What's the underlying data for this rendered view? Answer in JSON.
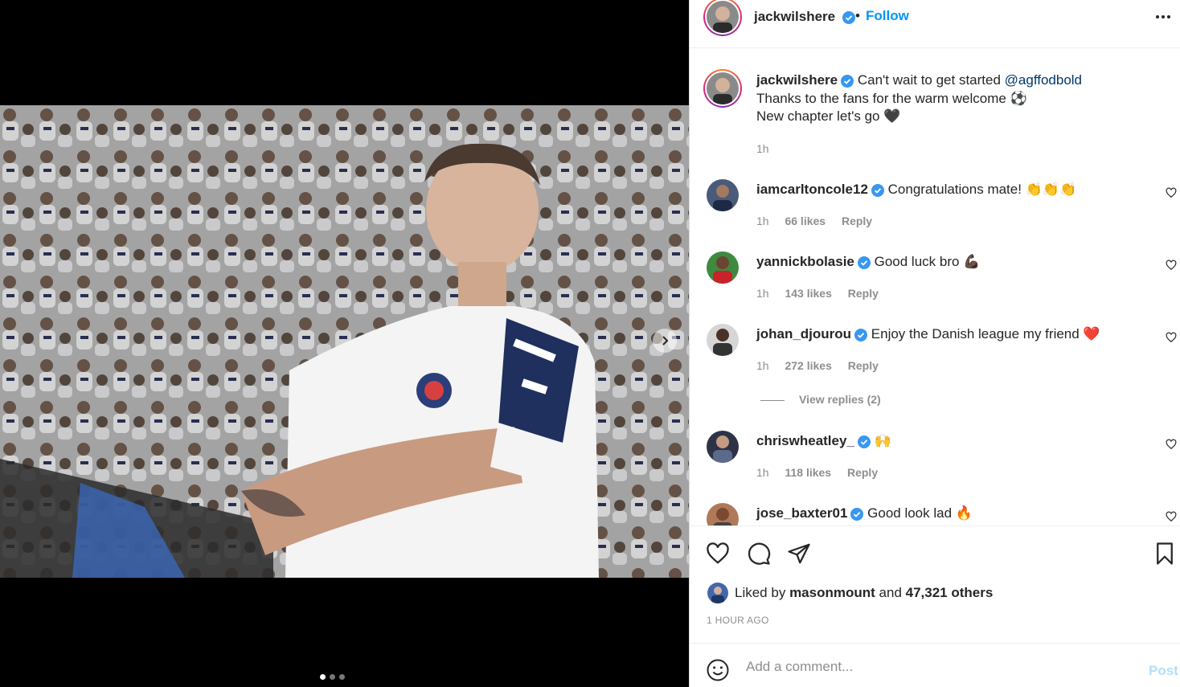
{
  "post": {
    "author": "jackwilshere",
    "follow_label": "Follow",
    "separator": "•",
    "caption": {
      "line1": "Can't wait to get started",
      "mention": "@agffodbold",
      "line2": "Thanks to the fans for the warm welcome ⚽",
      "line3": "New chapter let's go 🖤",
      "time": "1h"
    },
    "carousel": {
      "current": 1,
      "total": 3
    }
  },
  "comments": [
    {
      "user": "iamcarltoncole12",
      "verified": true,
      "text": "Congratulations mate! 👏👏👏",
      "time": "1h",
      "likes": "66 likes",
      "reply": "Reply"
    },
    {
      "user": "yannickbolasie",
      "verified": true,
      "text": "Good luck bro 💪🏿",
      "time": "1h",
      "likes": "143 likes",
      "reply": "Reply"
    },
    {
      "user": "johan_djourou",
      "verified": true,
      "text": "Enjoy the Danish league my friend ❤️",
      "time": "1h",
      "likes": "272 likes",
      "reply": "Reply",
      "view_replies": "View replies (2)"
    },
    {
      "user": "chriswheatley_",
      "verified": true,
      "text": "🙌",
      "time": "1h",
      "likes": "118 likes",
      "reply": "Reply"
    },
    {
      "user": "jose_baxter01",
      "verified": true,
      "text": "Good look lad 🔥"
    }
  ],
  "engagement": {
    "liked_by_prefix": "Liked by",
    "liked_by_user": "masonmount",
    "and": "and",
    "others": "47,321 others",
    "time_ago": "1 HOUR AGO"
  },
  "composer": {
    "placeholder": "Add a comment...",
    "post_label": "Post"
  },
  "colors": {
    "link_blue": "#0095f6",
    "mention": "#00376b",
    "verified": "#3897f0",
    "muted": "#8e8e8e",
    "post_disabled": "#b2dffc"
  },
  "icons": [
    "verified-icon",
    "more-icon",
    "heart-icon",
    "comment-icon",
    "share-icon",
    "bookmark-icon",
    "emoji-icon",
    "chevron-right-icon"
  ]
}
